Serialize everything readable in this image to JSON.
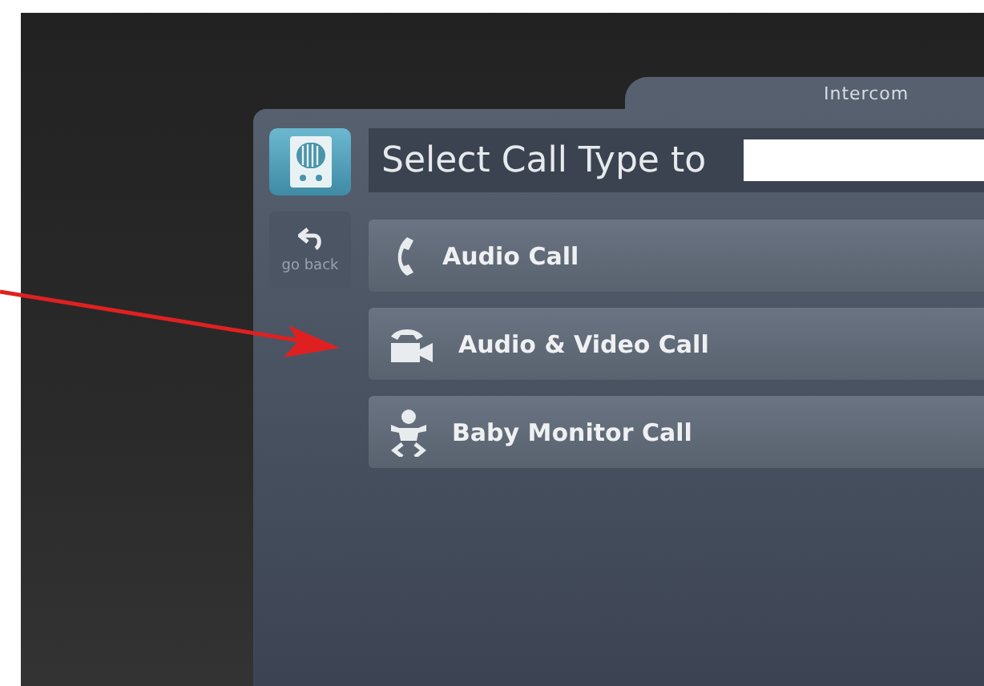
{
  "window": {
    "title": "Intercom"
  },
  "header": {
    "title": "Select Call Type to"
  },
  "back_button": {
    "label": "go back"
  },
  "call_types": [
    {
      "kind": "audio",
      "label": "Audio Call"
    },
    {
      "kind": "video",
      "label": "Audio & Video Call"
    },
    {
      "kind": "baby",
      "label": "Baby Monitor Call"
    }
  ]
}
